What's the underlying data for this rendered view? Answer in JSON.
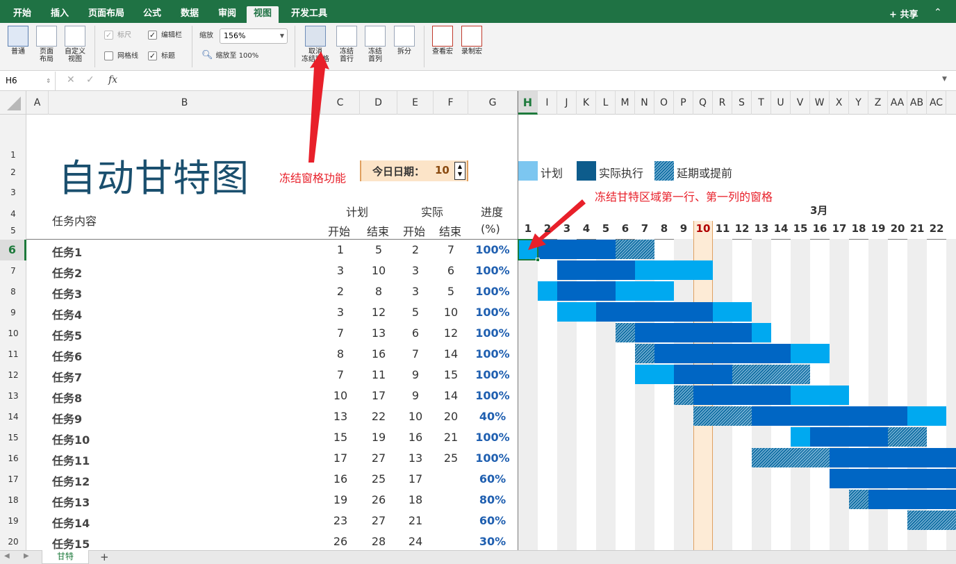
{
  "ribbon": {
    "tabs": [
      "开始",
      "插入",
      "页面布局",
      "公式",
      "数据",
      "审阅",
      "视图",
      "开发工具"
    ],
    "active_tab": "视图",
    "share_label": "共享",
    "views": [
      {
        "lines": [
          "普通"
        ]
      },
      {
        "lines": [
          "页面",
          "布局"
        ]
      },
      {
        "lines": [
          "自定义",
          "视图"
        ]
      }
    ],
    "checks": {
      "ruler": "标尺",
      "formula_bar": "编辑栏",
      "gridlines": "网格线",
      "headings": "标题"
    },
    "zoom_label": "缩放",
    "zoom_value": "156%",
    "zoom_to_100": "缩放至 100%",
    "freeze": [
      {
        "lines": [
          "取消",
          "冻结窗格"
        ]
      },
      {
        "lines": [
          "冻结",
          "首行"
        ]
      },
      {
        "lines": [
          "冻结",
          "首列"
        ]
      },
      {
        "lines": [
          "拆分"
        ]
      }
    ],
    "macros": [
      {
        "lines": [
          "查看宏"
        ]
      },
      {
        "lines": [
          "录制宏"
        ]
      }
    ]
  },
  "formula_bar": {
    "name_box": "H6",
    "fx": "fx",
    "content": ""
  },
  "columns_left": [
    "A",
    "B",
    "C",
    "D",
    "E",
    "F",
    "G"
  ],
  "columns_right": [
    "H",
    "I",
    "J",
    "K",
    "L",
    "M",
    "N",
    "O",
    "P",
    "Q",
    "R",
    "S",
    "T",
    "U",
    "V",
    "W",
    "X",
    "Y",
    "Z",
    "AA",
    "AB",
    "AC"
  ],
  "row_numbers": [
    "1",
    "2",
    "3",
    "4",
    "5",
    "6",
    "7",
    "8",
    "9",
    "10",
    "11",
    "12",
    "13",
    "14",
    "15",
    "16",
    "17",
    "18",
    "19",
    "20"
  ],
  "sheet": {
    "title": "自动甘特图",
    "today_label": "今日日期：",
    "today_value": "10",
    "task_header": "任务内容",
    "plan_header": "计划",
    "actual_header": "实际",
    "progress_header": "进度",
    "start": "开始",
    "end": "结束",
    "pct_unit": "(%)",
    "legend": {
      "plan": "计划",
      "actual": "实际执行",
      "delay": "延期或提前"
    },
    "month": "3月",
    "days": [
      "1",
      "2",
      "3",
      "4",
      "5",
      "6",
      "7",
      "8",
      "9",
      "10",
      "11",
      "12",
      "13",
      "14",
      "15",
      "16",
      "17",
      "18",
      "19",
      "20",
      "21",
      "22"
    ],
    "tasks": [
      {
        "name": "任务1",
        "ps": "1",
        "pe": "5",
        "as": "2",
        "ae": "7",
        "pct": "100%"
      },
      {
        "name": "任务2",
        "ps": "3",
        "pe": "10",
        "as": "3",
        "ae": "6",
        "pct": "100%"
      },
      {
        "name": "任务3",
        "ps": "2",
        "pe": "8",
        "as": "3",
        "ae": "5",
        "pct": "100%"
      },
      {
        "name": "任务4",
        "ps": "3",
        "pe": "12",
        "as": "5",
        "ae": "10",
        "pct": "100%"
      },
      {
        "name": "任务5",
        "ps": "7",
        "pe": "13",
        "as": "6",
        "ae": "12",
        "pct": "100%"
      },
      {
        "name": "任务6",
        "ps": "8",
        "pe": "16",
        "as": "7",
        "ae": "14",
        "pct": "100%"
      },
      {
        "name": "任务7",
        "ps": "7",
        "pe": "11",
        "as": "9",
        "ae": "15",
        "pct": "100%"
      },
      {
        "name": "任务8",
        "ps": "10",
        "pe": "17",
        "as": "9",
        "ae": "14",
        "pct": "100%"
      },
      {
        "name": "任务9",
        "ps": "13",
        "pe": "22",
        "as": "10",
        "ae": "20",
        "pct": "40%"
      },
      {
        "name": "任务10",
        "ps": "15",
        "pe": "19",
        "as": "16",
        "ae": "21",
        "pct": "100%"
      },
      {
        "name": "任务11",
        "ps": "17",
        "pe": "27",
        "as": "13",
        "ae": "25",
        "pct": "100%"
      },
      {
        "name": "任务12",
        "ps": "16",
        "pe": "25",
        "as": "17",
        "ae": "",
        "pct": "60%"
      },
      {
        "name": "任务13",
        "ps": "19",
        "pe": "26",
        "as": "18",
        "ae": "",
        "pct": "80%"
      },
      {
        "name": "任务14",
        "ps": "23",
        "pe": "27",
        "as": "21",
        "ae": "",
        "pct": "60%"
      },
      {
        "name": "任务15",
        "ps": "26",
        "pe": "28",
        "as": "24",
        "ae": "",
        "pct": "30%"
      }
    ]
  },
  "gantt_rows": [
    [
      {
        "k": "plan",
        "s": 1,
        "e": 1
      },
      {
        "k": "act",
        "s": 2,
        "e": 5
      },
      {
        "k": "delay",
        "s": 6,
        "e": 7
      }
    ],
    [
      {
        "k": "act",
        "s": 3,
        "e": 6
      },
      {
        "k": "plan",
        "s": 7,
        "e": 10
      }
    ],
    [
      {
        "k": "plan",
        "s": 2,
        "e": 2
      },
      {
        "k": "act",
        "s": 3,
        "e": 5
      },
      {
        "k": "plan",
        "s": 6,
        "e": 8
      }
    ],
    [
      {
        "k": "plan",
        "s": 3,
        "e": 4
      },
      {
        "k": "act",
        "s": 5,
        "e": 10
      },
      {
        "k": "plan",
        "s": 11,
        "e": 12
      }
    ],
    [
      {
        "k": "delay",
        "s": 6,
        "e": 6
      },
      {
        "k": "act",
        "s": 7,
        "e": 12
      },
      {
        "k": "plan",
        "s": 13,
        "e": 13
      }
    ],
    [
      {
        "k": "delay",
        "s": 7,
        "e": 7
      },
      {
        "k": "act",
        "s": 8,
        "e": 14
      },
      {
        "k": "plan",
        "s": 15,
        "e": 16
      }
    ],
    [
      {
        "k": "plan",
        "s": 7,
        "e": 8
      },
      {
        "k": "act",
        "s": 9,
        "e": 11
      },
      {
        "k": "delay",
        "s": 12,
        "e": 15
      }
    ],
    [
      {
        "k": "delay",
        "s": 9,
        "e": 9
      },
      {
        "k": "act",
        "s": 10,
        "e": 14
      },
      {
        "k": "plan",
        "s": 15,
        "e": 17
      }
    ],
    [
      {
        "k": "delay",
        "s": 10,
        "e": 12
      },
      {
        "k": "act",
        "s": 13,
        "e": 20
      },
      {
        "k": "plan",
        "s": 21,
        "e": 22
      }
    ],
    [
      {
        "k": "plan",
        "s": 15,
        "e": 15
      },
      {
        "k": "act",
        "s": 16,
        "e": 19
      },
      {
        "k": "delay",
        "s": 20,
        "e": 21
      }
    ],
    [
      {
        "k": "delay",
        "s": 13,
        "e": 16
      },
      {
        "k": "act",
        "s": 17,
        "e": 23
      }
    ],
    [
      {
        "k": "act",
        "s": 17,
        "e": 23
      }
    ],
    [
      {
        "k": "delay",
        "s": 18,
        "e": 18
      },
      {
        "k": "act",
        "s": 19,
        "e": 23
      }
    ],
    [
      {
        "k": "delay",
        "s": 21,
        "e": 23
      }
    ],
    []
  ],
  "annotations": {
    "freeze_feature": "冻结窗格功能",
    "freeze_region": "冻结甘特区域第一行、第一列的窗格"
  },
  "sheet_tab": "甘特",
  "colors": {
    "ribbon_green": "#1f7244",
    "plan": "#00a9f0",
    "actual": "#0066c4",
    "title": "#1a4f6e",
    "annotation": "#e8202a"
  }
}
